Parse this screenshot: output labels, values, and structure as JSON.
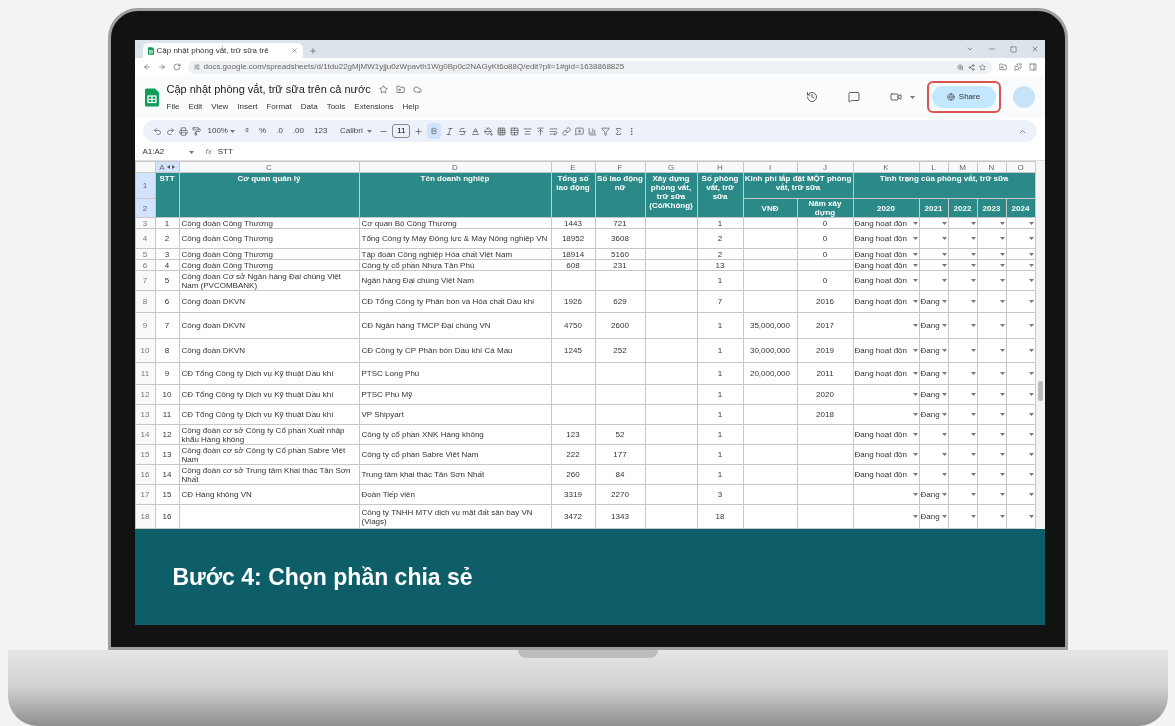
{
  "browser": {
    "tab_title": "Cập nhật phòng vắt, trữ sữa trê",
    "url": "docs.google.com/spreadsheets/d/1tdu22gMjMW1yjju0zWpavth1Wg0Bp0c2NAGyKt6o88Q/edit?pli=1#gid=1638868825"
  },
  "doc": {
    "title": "Cập nhật phòng vắt, trữ sữa trên cả nước",
    "menus": [
      "File",
      "Edit",
      "View",
      "Insert",
      "Format",
      "Data",
      "Tools",
      "Extensions",
      "Help"
    ],
    "share_label": "Share"
  },
  "toolbar": {
    "zoom": "100%",
    "currency": "₫",
    "percent": "%",
    "decrease_decimals": ".0",
    "increase_decimals": ".00",
    "number_format": "123",
    "font": "Calibri",
    "font_size": "11",
    "bold_selected": true
  },
  "formula_bar": {
    "cell_ref": "A1:A2",
    "fx": "fx",
    "formula": "STT"
  },
  "sheet": {
    "column_letters": [
      {
        "label": "A",
        "selected": true
      },
      {
        "label": "C",
        "selected": false
      },
      {
        "label": "D",
        "selected": false
      },
      {
        "label": "E",
        "selected": false
      },
      {
        "label": "F",
        "selected": false
      },
      {
        "label": "G",
        "selected": false
      },
      {
        "label": "H",
        "selected": false
      },
      {
        "label": "I",
        "selected": false
      },
      {
        "label": "J",
        "selected": false
      },
      {
        "label": "K",
        "selected": false
      },
      {
        "label": "L",
        "selected": false
      },
      {
        "label": "M",
        "selected": false
      },
      {
        "label": "N",
        "selected": false
      },
      {
        "label": "O",
        "selected": false
      }
    ],
    "header_rows": [
      {
        "number": "1",
        "selected": true
      },
      {
        "number": "2",
        "selected": true
      }
    ],
    "headers": [
      "STT",
      "Cơ quan quản lý",
      "Tên doanh nghiệp",
      "Tổng số lao động",
      "Số lao động nữ",
      "Xây dựng phòng vắt, trữ sữa (Có/Không)",
      "Số phòng vắt, trữ sữa",
      "Kinh phí lắp đặt MỘT phòng vắt, trữ sữa",
      "Tình trạng của phòng vắt, trữ sữa"
    ],
    "subheaders": [
      "VNĐ",
      "Năm xây dựng",
      "2020",
      "2021",
      "2022",
      "2023",
      "2024"
    ],
    "rows": [
      {
        "number": "3",
        "selected": false,
        "stt": "1",
        "agency": "Công đoàn Công Thương",
        "company": "Cơ quan Bộ Công Thương",
        "total": "1443",
        "female": "721",
        "rooms": "1",
        "year": "0",
        "status_2020": "Đang hoạt độn"
      },
      {
        "number": "4",
        "selected": false,
        "stt": "2",
        "agency": "Công đoàn Công Thương",
        "company": "Tổng Công ty Máy Động lực & Máy Nông nghiệp VN",
        "total": "18952",
        "female": "3608",
        "rooms": "2",
        "year": "0",
        "status_2020": "Đang hoạt độn"
      },
      {
        "number": "5",
        "selected": false,
        "stt": "3",
        "agency": "Công đoàn Công Thương",
        "company": "Tập đoàn Công nghiệp Hóa chất Việt Nam",
        "total": "18914",
        "female": "5160",
        "rooms": "2",
        "year": "0",
        "status_2020": "Đang hoạt độn"
      },
      {
        "number": "6",
        "selected": false,
        "stt": "4",
        "agency": "Công đoàn Công Thương",
        "company": "Công ty cổ phần Nhựa Tân Phú",
        "total": "608",
        "female": "231",
        "rooms": "13",
        "status_2020": "Đang hoạt độn"
      },
      {
        "number": "7",
        "selected": false,
        "stt": "5",
        "agency": "Công đoàn Cơ sở Ngân hàng Đại chúng Việt Nam (PVCOMBANK)",
        "company": "Ngân hàng Đại chúng Việt Nam",
        "rooms": "1",
        "year": "0",
        "status_2020": "Đang hoạt độn"
      },
      {
        "number": "8",
        "selected": false,
        "stt": "6",
        "agency": "Công đoàn DKVN",
        "company": "CĐ Tổng Công ty Phân bón và Hóa chất Dầu khí",
        "total": "1926",
        "female": "629",
        "rooms": "7",
        "year": "2016",
        "status_2020": "Đang hoạt độn",
        "status_2021": "Đang"
      },
      {
        "number": "9",
        "selected": false,
        "stt": "7",
        "agency": "Công đoàn DKVN",
        "company": "CĐ Ngân hàng TMCP Đại chúng VN",
        "total": "4750",
        "female": "2600",
        "rooms": "1",
        "cost": "35,000,000",
        "year": "2017",
        "status_2021": "Đang"
      },
      {
        "number": "10",
        "selected": false,
        "stt": "8",
        "agency": "Công đoàn DKVN",
        "company": "CĐ Công ty CP Phân bón Dầu khí Cà Mau",
        "total": "1245",
        "female": "252",
        "rooms": "1",
        "cost": "30,000,000",
        "year": "2019",
        "status_2020": "Đang hoạt độn",
        "status_2021": "Đang"
      },
      {
        "number": "11",
        "selected": false,
        "stt": "9",
        "agency": "CĐ Tổng Công ty Dịch vụ Kỹ thuật Dầu khí",
        "company": "PTSC Long Phú",
        "rooms": "1",
        "cost": "20,000,000",
        "year": "2011",
        "status_2020": "Đang hoạt độn",
        "status_2021": "Đang"
      },
      {
        "number": "12",
        "selected": false,
        "stt": "10",
        "agency": "CĐ Tổng Công ty Dịch vụ Kỹ thuật Dầu khí",
        "company": "PTSC Phù Mỹ",
        "rooms": "1",
        "year": "2020",
        "status_2021": "Đang"
      },
      {
        "number": "13",
        "selected": false,
        "stt": "11",
        "agency": "CĐ Tổng Công ty Dịch vụ Kỹ thuật Dầu khí",
        "company": "VP Shipyart",
        "rooms": "1",
        "year": "2018",
        "status_2021": "Đang"
      },
      {
        "number": "14",
        "selected": false,
        "stt": "12",
        "agency": "Công đoàn cơ sở Công ty Cổ phần Xuất nhập khẩu Hàng không",
        "company": "Công ty cổ phần XNK Hàng không",
        "total": "123",
        "female": "52",
        "rooms": "1",
        "status_2020": "Đang hoạt độn"
      },
      {
        "number": "15",
        "selected": false,
        "stt": "13",
        "agency": "Công đoàn cơ sở Công ty Cổ phần Sabre Việt Nam",
        "company": "Công ty cổ phần Sabre Việt Nam",
        "total": "222",
        "female": "177",
        "rooms": "1",
        "status_2020": "Đang hoạt độn"
      },
      {
        "number": "16",
        "selected": false,
        "stt": "14",
        "agency": "Công đoàn cơ sở Trung tâm Khai thác Tân Sơn Nhất",
        "company": "Trung tâm khai thác Tân Sơn Nhất",
        "total": "260",
        "female": "84",
        "rooms": "1",
        "status_2020": "Đang hoạt độn"
      },
      {
        "number": "17",
        "selected": false,
        "stt": "15",
        "agency": "CĐ Hàng không VN",
        "company": "Đoàn Tiếp viên",
        "total": "3319",
        "female": "2270",
        "rooms": "3",
        "status_2021": "Đang"
      },
      {
        "number": "18",
        "selected": false,
        "stt": "16",
        "company": "Công ty TNHH MTV dịch vụ mặt đất sân bay VN (Viags)",
        "total": "3472",
        "female": "1343",
        "rooms": "18",
        "status_2021": "Đang"
      }
    ]
  },
  "caption": "Bước 4: Chọn phần chia sẻ"
}
